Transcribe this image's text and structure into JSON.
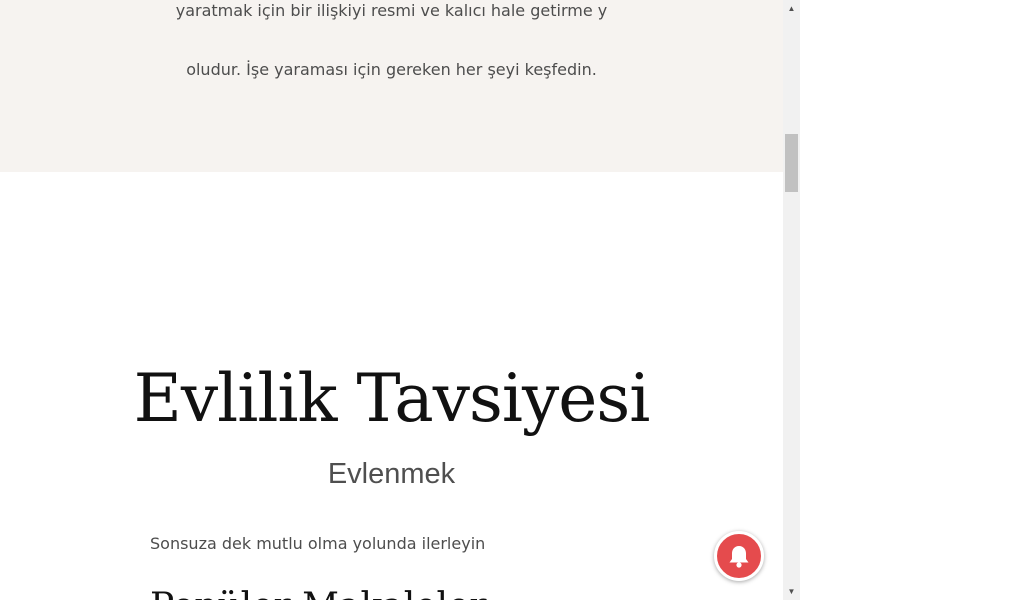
{
  "intro": {
    "line1": "yaratmak için bir ilişkiyi resmi ve kalıcı hale getirme y",
    "line2": "oludur. İşe yaraması için gereken her şeyi keşfedin."
  },
  "section": {
    "title": "Evlilik Tavsiyesi",
    "subtitle": "Evlenmek",
    "body": "Sonsuza dek mutlu olma yolunda ilerleyin",
    "next_heading": "Popüler Makaleler"
  },
  "scrollbar": {
    "up_arrow": "▲",
    "down_arrow": "▼"
  },
  "icons": {
    "notification": "bell-icon"
  },
  "colors": {
    "beige_background": "#f6f3f0",
    "notification_button": "#e54b4d"
  }
}
